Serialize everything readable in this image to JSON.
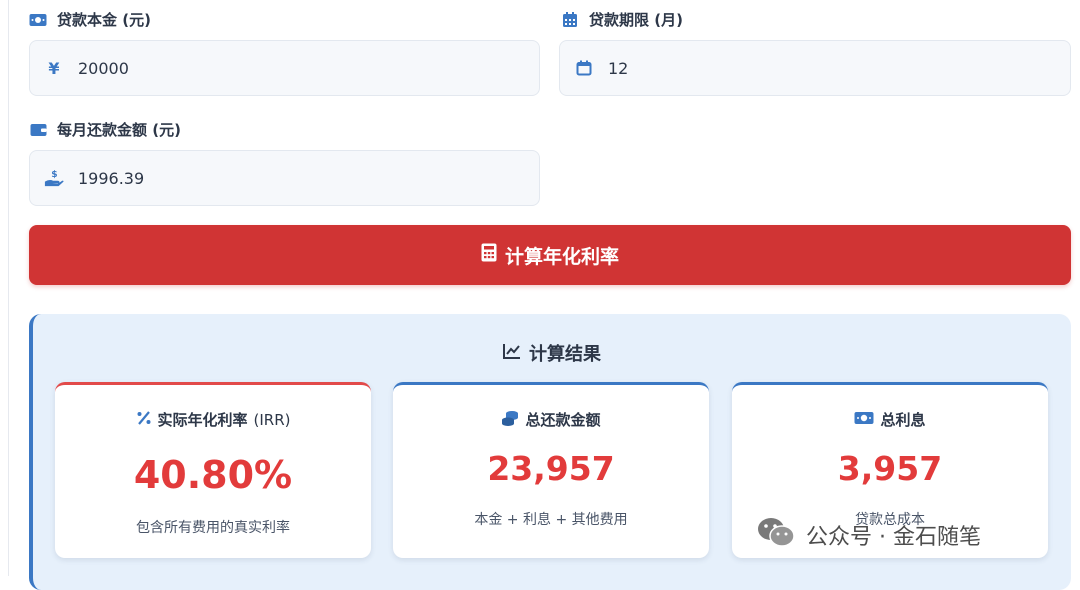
{
  "form": {
    "principal": {
      "label": "贷款本金 (元)",
      "icon": "money-bill-icon",
      "prefix_icon": "yen-icon",
      "value": "20000"
    },
    "term": {
      "label": "贷款期限 (月)",
      "icon": "calendar-grid-icon",
      "prefix_icon": "calendar-icon",
      "value": "12"
    },
    "monthly": {
      "label": "每月还款金额 (元)",
      "icon": "wallet-icon",
      "prefix_icon": "hand-dollar-icon",
      "value": "1996.39"
    }
  },
  "button": {
    "label": "计算年化利率",
    "icon": "calculator-icon"
  },
  "results": {
    "title": "计算结果",
    "cards": [
      {
        "title": "实际年化利率",
        "title_suffix": "(IRR)",
        "value": "40.80%",
        "note": "包含所有费用的真实利率"
      },
      {
        "title": "总还款金额",
        "value": "23,957",
        "note": "本金 + 利息 + 其他费用"
      },
      {
        "title": "总利息",
        "value": "3,957",
        "note": "贷款总成本"
      }
    ]
  },
  "watermark": "公众号 · 金石随笔",
  "colors": {
    "accent_blue": "#3b78c4",
    "button_red": "#d03434",
    "value_red": "#e23b3b",
    "panel_bg": "#e6f0fb"
  }
}
